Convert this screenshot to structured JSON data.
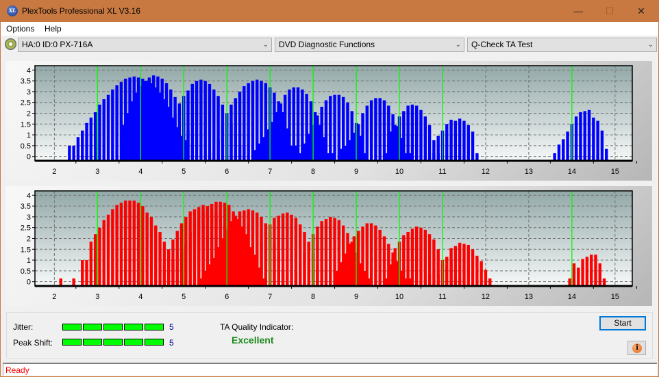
{
  "window": {
    "title": "PlexTools Professional XL V3.16",
    "icon": "xl-logo-icon",
    "icon_text": "XL",
    "controls": {
      "minimize": "—",
      "maximize": "☐",
      "close": "✕"
    }
  },
  "menu": {
    "items": [
      "Options",
      "Help"
    ]
  },
  "toolbar": {
    "drive": "HA:0 ID:0  PX-716A",
    "function": "DVD Diagnostic Functions",
    "test": "Q-Check TA Test"
  },
  "results": {
    "jitter_label": "Jitter:",
    "jitter_value": "5",
    "jitter_level": 5,
    "peak_shift_label": "Peak Shift:",
    "peak_shift_value": "5",
    "peak_shift_level": 5,
    "meter_segments": 5,
    "meter_color": "#00ff00",
    "ta_quality_label": "TA Quality Indicator:",
    "ta_quality_value": "Excellent"
  },
  "buttons": {
    "start": "Start",
    "info": "i"
  },
  "status": {
    "text": "Ready"
  },
  "chart_data": [
    {
      "type": "bar",
      "title": "",
      "series_color": "#0000ff",
      "marker_color": "#00ff00",
      "xlim": [
        1.55,
        15.4
      ],
      "ylim": [
        -0.2,
        4.2
      ],
      "xticks": [
        "2",
        "3",
        "4",
        "5",
        "6",
        "7",
        "8",
        "9",
        "10",
        "11",
        "12",
        "13",
        "14",
        "15"
      ],
      "yticks": [
        "0",
        "0.5",
        "1",
        "1.5",
        "2",
        "2.5",
        "3",
        "3.5",
        "4"
      ],
      "markers": [
        3,
        4,
        5,
        6,
        7,
        8,
        9,
        10,
        11,
        14
      ],
      "grid": true,
      "clusters": [
        {
          "start": 2.35,
          "values": [
            0.5,
            0.5,
            0.9,
            1.2,
            1.55,
            1.8,
            2.05,
            2.4,
            2.65,
            2.85,
            3.1,
            3.3,
            3.45,
            3.6,
            3.65,
            3.7,
            3.65,
            3.6,
            3.5,
            3.4,
            3.2,
            2.95,
            2.65,
            2.3,
            1.8,
            1.35,
            0.95,
            0.75
          ]
        },
        {
          "start": 3.6,
          "values": [
            1.45,
            2.0,
            2.55,
            2.95,
            3.25,
            3.5,
            3.65,
            3.75,
            3.7,
            3.6,
            3.4,
            3.1,
            2.75,
            2.3,
            1.75,
            1.2,
            0.6
          ]
        },
        {
          "start": 4.5,
          "values": [
            0.3,
            1.0,
            1.5,
            2.0,
            2.45,
            2.8,
            3.05,
            3.35,
            3.5,
            3.55,
            3.5,
            3.35,
            3.1,
            2.8,
            2.4,
            1.95,
            1.45,
            0.95,
            0.5,
            0.5
          ]
        },
        {
          "start": 5.6,
          "values": [
            0.15,
            0.3,
            0.8,
            1.5,
            2.0,
            2.4,
            2.7,
            3.0,
            3.25,
            3.4,
            3.5,
            3.55,
            3.5,
            3.4,
            3.2,
            2.95,
            2.55,
            2.05,
            1.3,
            0.5,
            0.5
          ]
        },
        {
          "start": 6.65,
          "values": [
            0.3,
            0.6,
            0.9,
            1.25,
            1.6,
            2.05,
            2.45,
            2.85,
            3.1,
            3.2,
            3.2,
            3.1,
            2.9,
            2.55,
            2.05,
            1.45,
            0.9,
            0.15,
            0.15
          ]
        },
        {
          "start": 7.7,
          "values": [
            0.15,
            0.6,
            1.05,
            1.45,
            1.9,
            2.3,
            2.6,
            2.8,
            2.85,
            2.85,
            2.75,
            2.5,
            2.1,
            1.55,
            0.95,
            0.15
          ]
        },
        {
          "start": 8.65,
          "values": [
            0.35,
            0.5,
            0.75,
            1.1,
            1.5,
            2.0,
            2.35,
            2.6,
            2.7,
            2.7,
            2.6,
            2.35,
            1.95,
            1.4,
            0.85,
            0.15,
            0.15
          ]
        },
        {
          "start": 9.7,
          "values": [
            0.15,
            1.15,
            1.45,
            1.85,
            2.1,
            2.35,
            2.4,
            2.35,
            2.15,
            1.85,
            1.45,
            0.75,
            0.15
          ]
        },
        {
          "start": 10.7,
          "values": [
            0.15,
            0.15,
            0.95,
            1.2,
            1.5,
            1.7,
            1.65,
            1.75,
            1.65,
            1.45,
            1.15,
            0.15
          ]
        },
        {
          "start": 13.6,
          "values": [
            0.15,
            0.55,
            0.8,
            1.15,
            1.5,
            1.85,
            2.05,
            2.1,
            2.15,
            1.8,
            1.65,
            1.2,
            0.35
          ]
        }
      ]
    },
    {
      "type": "bar",
      "title": "",
      "series_color": "#ff0000",
      "marker_color": "#00ff00",
      "xlim": [
        1.55,
        15.4
      ],
      "ylim": [
        -0.2,
        4.2
      ],
      "xticks": [
        "2",
        "3",
        "4",
        "5",
        "6",
        "7",
        "8",
        "9",
        "10",
        "11",
        "12",
        "13",
        "14",
        "15"
      ],
      "yticks": [
        "0",
        "0.5",
        "1",
        "1.5",
        "2",
        "2.5",
        "3",
        "3.5",
        "4"
      ],
      "markers": [
        3,
        4,
        5,
        6,
        7,
        8,
        9,
        10,
        11,
        14
      ],
      "grid": true,
      "clusters": [
        {
          "start": 2.15,
          "values": [
            0.15
          ]
        },
        {
          "start": 2.45,
          "values": [
            0.15,
            0,
            1.0,
            1.0,
            1.85,
            2.2,
            2.5,
            2.85,
            3.1,
            3.35,
            3.55,
            3.65,
            3.75,
            3.75,
            3.75,
            3.65,
            3.5,
            3.2,
            3.0,
            2.6,
            2.3,
            1.85,
            1.45,
            1.0,
            0.9,
            1.5,
            1.75,
            2.3,
            2.7,
            3.0,
            3.25,
            3.5,
            3.6,
            3.7,
            3.7,
            3.65,
            3.55,
            3.25,
            2.9,
            2.55,
            2.2,
            1.6,
            1.25,
            0.65,
            0.15
          ]
        },
        {
          "start": 4.55,
          "values": [
            0.9,
            1.5,
            1.95,
            2.35,
            2.7,
            3.0,
            3.25,
            3.35,
            3.45,
            3.55,
            3.5,
            3.4,
            3.2,
            2.95,
            2.55,
            2.0,
            1.55,
            1.15
          ]
        },
        {
          "start": 5.4,
          "values": [
            0.15,
            0.5,
            0.8,
            1.1,
            1.6,
            2.0,
            2.4,
            2.8,
            3.05,
            3.25,
            3.3,
            3.35,
            3.3,
            3.2,
            3.0,
            2.7,
            2.3,
            1.8,
            1.3,
            0.5,
            0.3
          ]
        },
        {
          "start": 6.5,
          "values": [
            0.5,
            0.95,
            1.4,
            1.85,
            2.3,
            2.65,
            2.95,
            3.05,
            3.15,
            3.2,
            3.1,
            2.95,
            2.65,
            2.3,
            1.85,
            1.3,
            0.8,
            0.4
          ]
        },
        {
          "start": 7.6,
          "values": [
            0.5,
            0.9,
            1.35,
            1.8,
            2.2,
            2.55,
            2.8,
            2.9,
            3.0,
            2.95,
            2.85,
            2.6,
            2.25,
            1.85,
            1.35,
            0.85,
            0.5,
            0.15
          ]
        },
        {
          "start": 8.55,
          "values": [
            0.5,
            0.9,
            1.3,
            1.75,
            2.1,
            2.35,
            2.55,
            2.7,
            2.7,
            2.6,
            2.4,
            2.1,
            1.75,
            1.35,
            0.95,
            0.5,
            0.15,
            0.15
          ]
        },
        {
          "start": 9.7,
          "values": [
            0.15,
            0.8,
            1.55,
            1.85,
            2.15,
            2.3,
            2.45,
            2.55,
            2.5,
            2.4,
            2.2,
            1.95,
            1.5,
            1.0,
            0.7,
            0.95,
            0.15,
            0.15
          ]
        },
        {
          "start": 10.7,
          "values": [
            0.35,
            0,
            0.35,
            0.8,
            1.15,
            1.55,
            1.65,
            1.8,
            1.75,
            1.7,
            1.5,
            1.2,
            0.95,
            0.55,
            0.15
          ]
        },
        {
          "start": 13.95,
          "values": [
            0.15,
            0.85,
            0.65,
            1.05,
            1.15,
            1.25,
            1.25,
            0.85,
            0.15
          ]
        }
      ]
    }
  ]
}
